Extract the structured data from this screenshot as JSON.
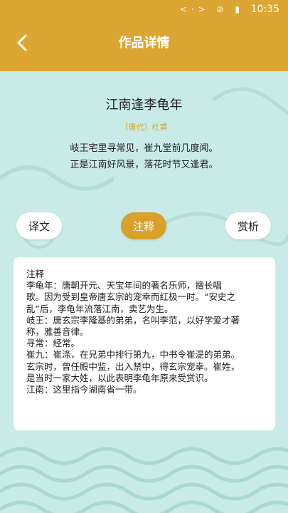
{
  "status_bar": {
    "icons": "<·> ⊘ ▮",
    "time": "10:35"
  },
  "header": {
    "title": "作品详情"
  },
  "poem": {
    "title": "江南逢李龟年",
    "author": "〔唐代〕杜甫",
    "lines": [
      "岐王宅里寻常见，崔九堂前几度闻。",
      "正是江南好风景，落花时节又逢君。"
    ]
  },
  "tabs": [
    {
      "label": "译文",
      "active": false
    },
    {
      "label": "注释",
      "active": true
    },
    {
      "label": "赏析",
      "active": false
    }
  ],
  "annotation": {
    "lines": [
      "注释",
      "李龟年：唐朝开元、天宝年间的著名乐师，擅长唱",
      "歌。因为受到皇帝唐玄宗的宠幸而红极一时。“安史之",
      "乱”后，李龟年流落江南，卖艺为生。",
      "岐王：唐玄宗李隆基的弟弟，名叫李范，以好学爱才著",
      "称，雅善音律。",
      "寻常：经常。",
      "崔九：崔涤，在兄弟中排行第九，中书令崔湜的弟弟。",
      "玄宗时，曾任殿中监，出入禁中，得玄宗宠幸。崔姓，",
      "是当时一家大姓，以此表明李龟年原来受赏识。",
      "江南：这里指今湖南省一带。"
    ]
  },
  "colors": {
    "accent": "#dca632",
    "background": "#c9ebe7"
  }
}
